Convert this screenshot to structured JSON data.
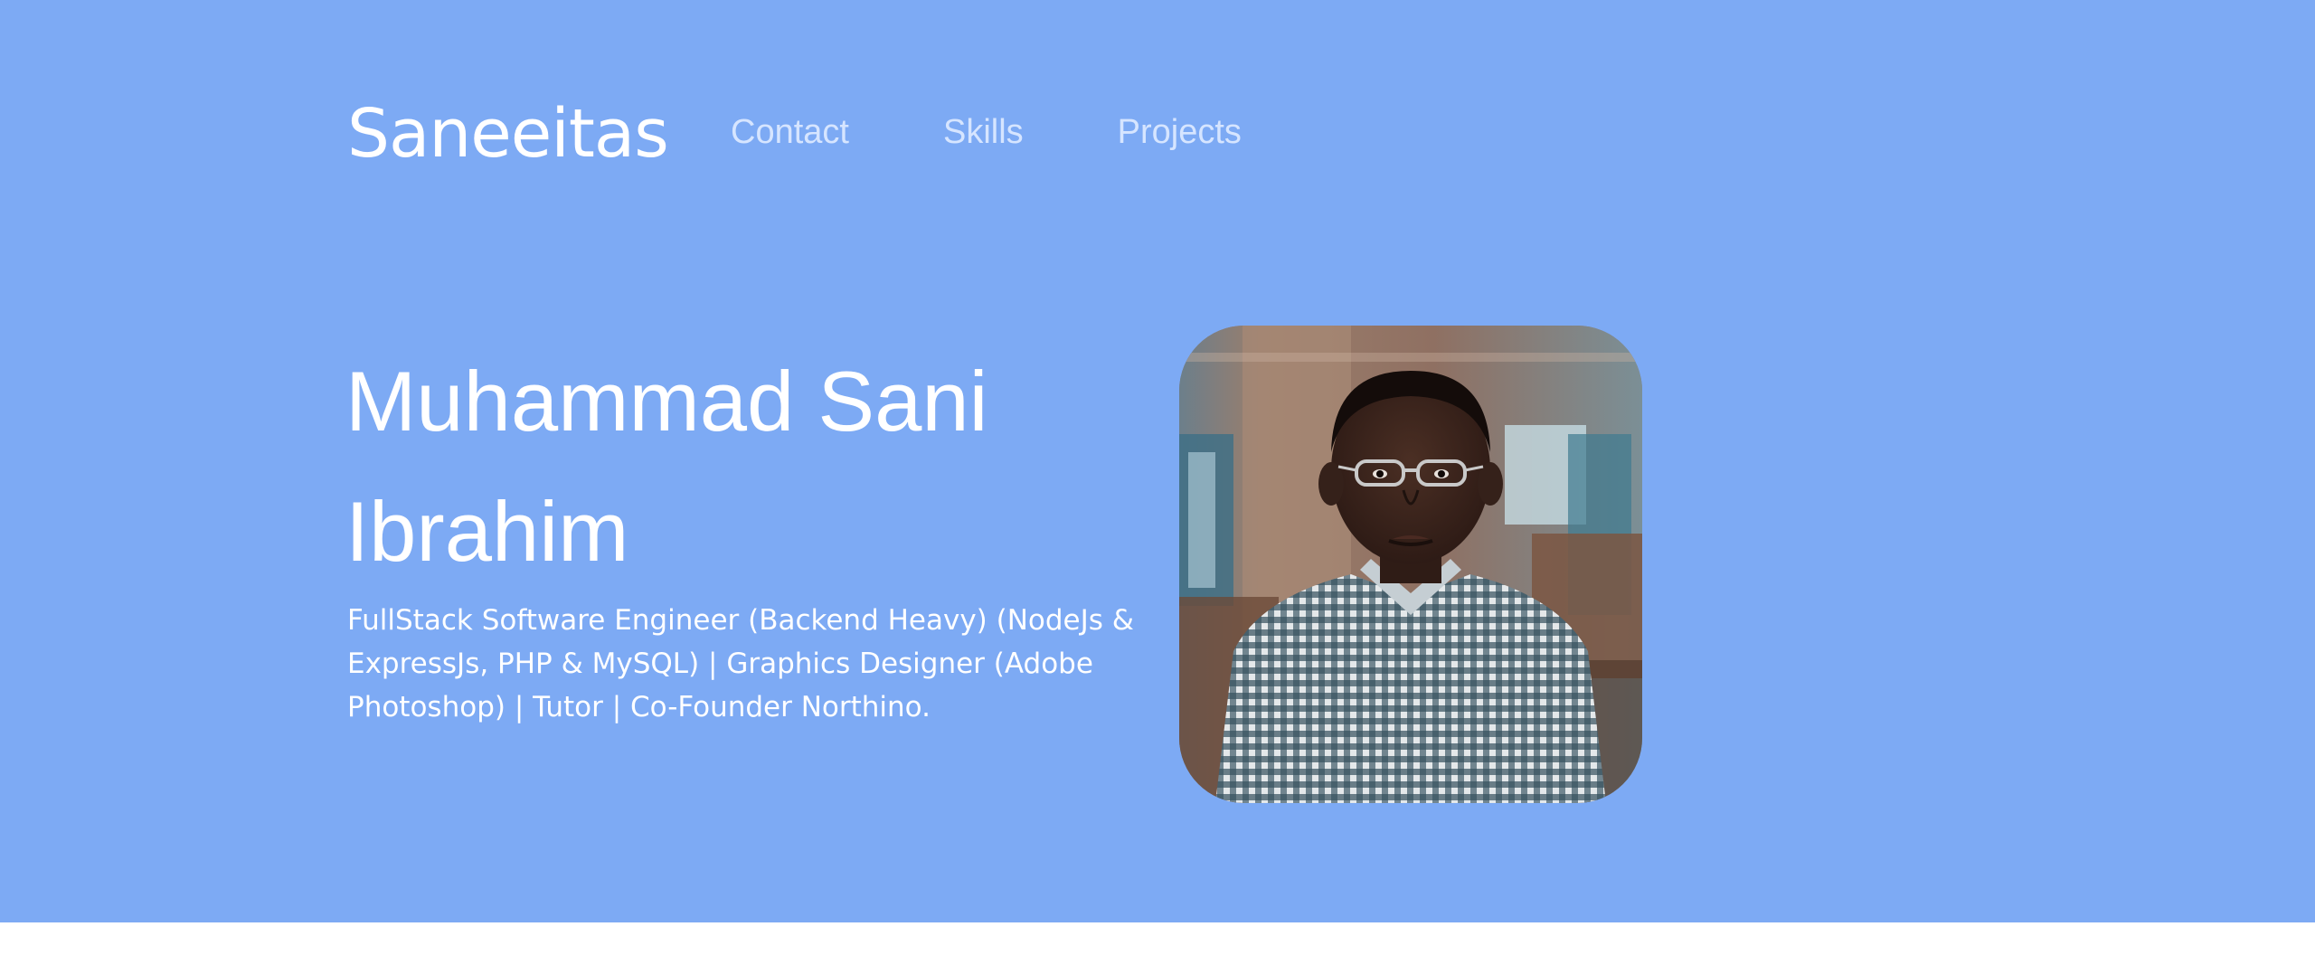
{
  "header": {
    "brand": "Saneeitas",
    "nav": [
      {
        "label": "Contact"
      },
      {
        "label": "Skills"
      },
      {
        "label": "Projects"
      }
    ]
  },
  "hero": {
    "name": "Muhammad Sani Ibrahim",
    "bio": "FullStack Software Engineer (Backend Heavy) (NodeJs & ExpressJs, PHP & MySQL) | Graphics Designer (Adobe Photoshop) | Tutor | Co-Founder Northino."
  },
  "colors": {
    "hero_background": "#7daaf4",
    "page_background": "#ffffff",
    "heading_text": "#ffffff",
    "nav_text": "#d6e5ff"
  }
}
